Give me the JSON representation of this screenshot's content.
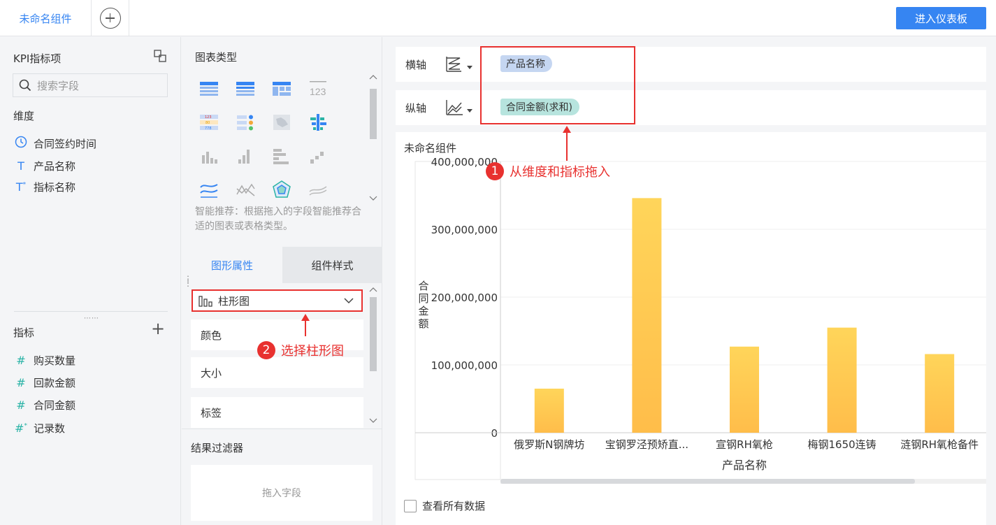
{
  "topbar": {
    "active_tab": "未命名组件",
    "enter_dashboard": "进入仪表板"
  },
  "left_panel": {
    "kpi_title": "KPI指标项",
    "search_placeholder": "搜索字段",
    "dimension_title": "维度",
    "dimensions": [
      {
        "icon": "clock-icon",
        "label": "合同签约时间"
      },
      {
        "icon": "text-icon",
        "label": "产品名称"
      },
      {
        "icon": "text-star-icon",
        "label": "指标名称"
      }
    ],
    "metric_title": "指标",
    "metrics": [
      {
        "icon": "hash-icon",
        "label": "购买数量"
      },
      {
        "icon": "hash-icon",
        "label": "回款金额"
      },
      {
        "icon": "hash-icon",
        "label": "合同金额"
      },
      {
        "icon": "hash-star-icon",
        "label": "记录数"
      }
    ]
  },
  "middle_panel": {
    "chart_type_title": "图表类型",
    "smart_hint": "智能推荐：根据拖入的字段智能推荐合适的图表或表格类型。",
    "tabs": [
      "图形属性",
      "组件样式"
    ],
    "chart_select": "柱形图",
    "properties": [
      "颜色",
      "大小",
      "标签"
    ],
    "result_filter_title": "结果过滤器",
    "drop_hint": "拖入字段"
  },
  "right_panel": {
    "x_axis_label": "横轴",
    "x_axis_field": "产品名称",
    "y_axis_label": "纵轴",
    "y_axis_field": "合同金额(求和)",
    "component_title": "未命名组件",
    "view_all": "查看所有数据"
  },
  "annotations": [
    {
      "num": "1",
      "text": "从维度和指标拖入"
    },
    {
      "num": "2",
      "text": "选择柱形图"
    }
  ],
  "colors": {
    "accent": "#3685f2",
    "annotation_red": "#e8312f",
    "bar_top": "#ffd55a",
    "bar_bottom": "#ffbd4a"
  },
  "chart_data": {
    "type": "bar",
    "categories": [
      "俄罗斯N钢牌坊",
      "宝钢罗泾预矫直...",
      "宣钢RH氧枪",
      "梅钢1650连铸",
      "涟钢RH氧枪备件"
    ],
    "values": [
      65000000,
      346000000,
      127000000,
      155000000,
      116000000
    ],
    "xlabel": "产品名称",
    "ylabel": "合同金额",
    "ylim": [
      0,
      400000000
    ],
    "yticks": [
      "0",
      "100,000,000",
      "200,000,000",
      "300,000,000",
      "400,000,000"
    ],
    "grid": true
  }
}
